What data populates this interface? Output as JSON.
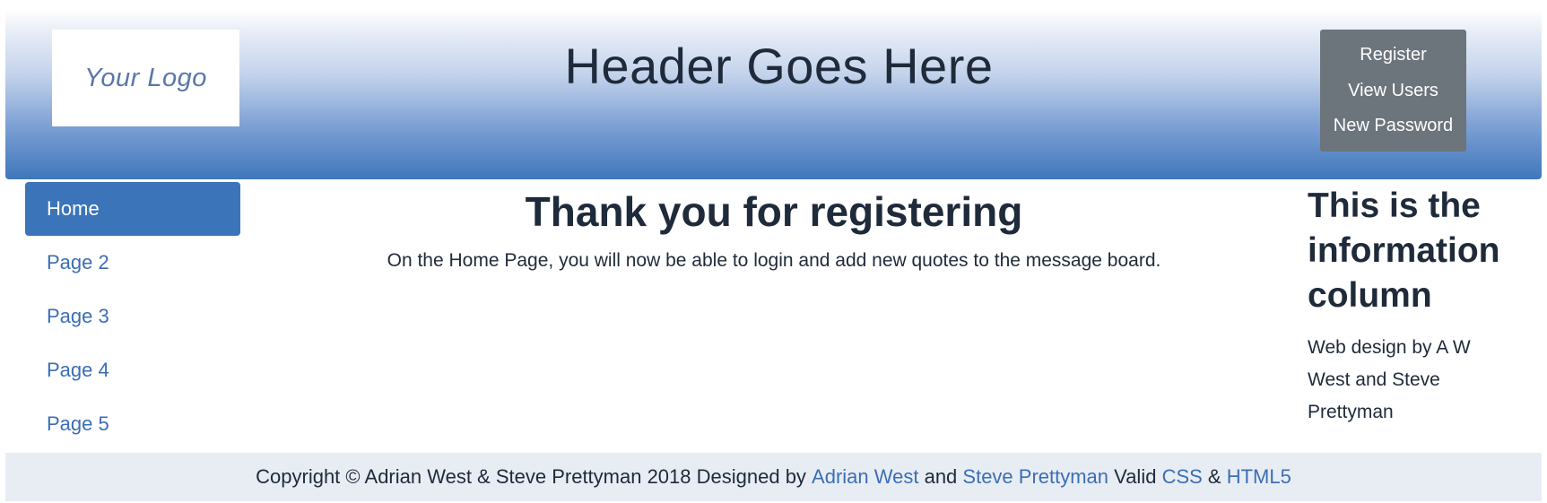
{
  "header": {
    "logo_text": "Your Logo",
    "title": "Header Goes Here",
    "user_menu": {
      "register": "Register",
      "view_users": "View Users",
      "new_password": "New Password"
    }
  },
  "nav": {
    "items": [
      {
        "label": "Home"
      },
      {
        "label": "Page 2"
      },
      {
        "label": "Page 3"
      },
      {
        "label": "Page 4"
      },
      {
        "label": "Page 5"
      }
    ],
    "active_index": 0
  },
  "main": {
    "title": "Thank you for registering",
    "text": "On the Home Page, you will now be able to login and add new quotes to the message board."
  },
  "info": {
    "title": "This is the information column",
    "credit": "Web design by A W West and Steve Prettyman"
  },
  "footer": {
    "copyright": "Copyright © Adrian West & Steve Prettyman 2018 Designed by ",
    "link_adrian": "Adrian West",
    "and": " and ",
    "link_steve": "Steve Prettyman",
    "valid": " Valid ",
    "link_css": "CSS",
    "amp": " & ",
    "link_html5": "HTML5"
  },
  "colors": {
    "accent": "#3c74b9",
    "link": "#3c6eb4",
    "menu_bg": "#6c747c",
    "footer_bg": "#e8edf4"
  }
}
